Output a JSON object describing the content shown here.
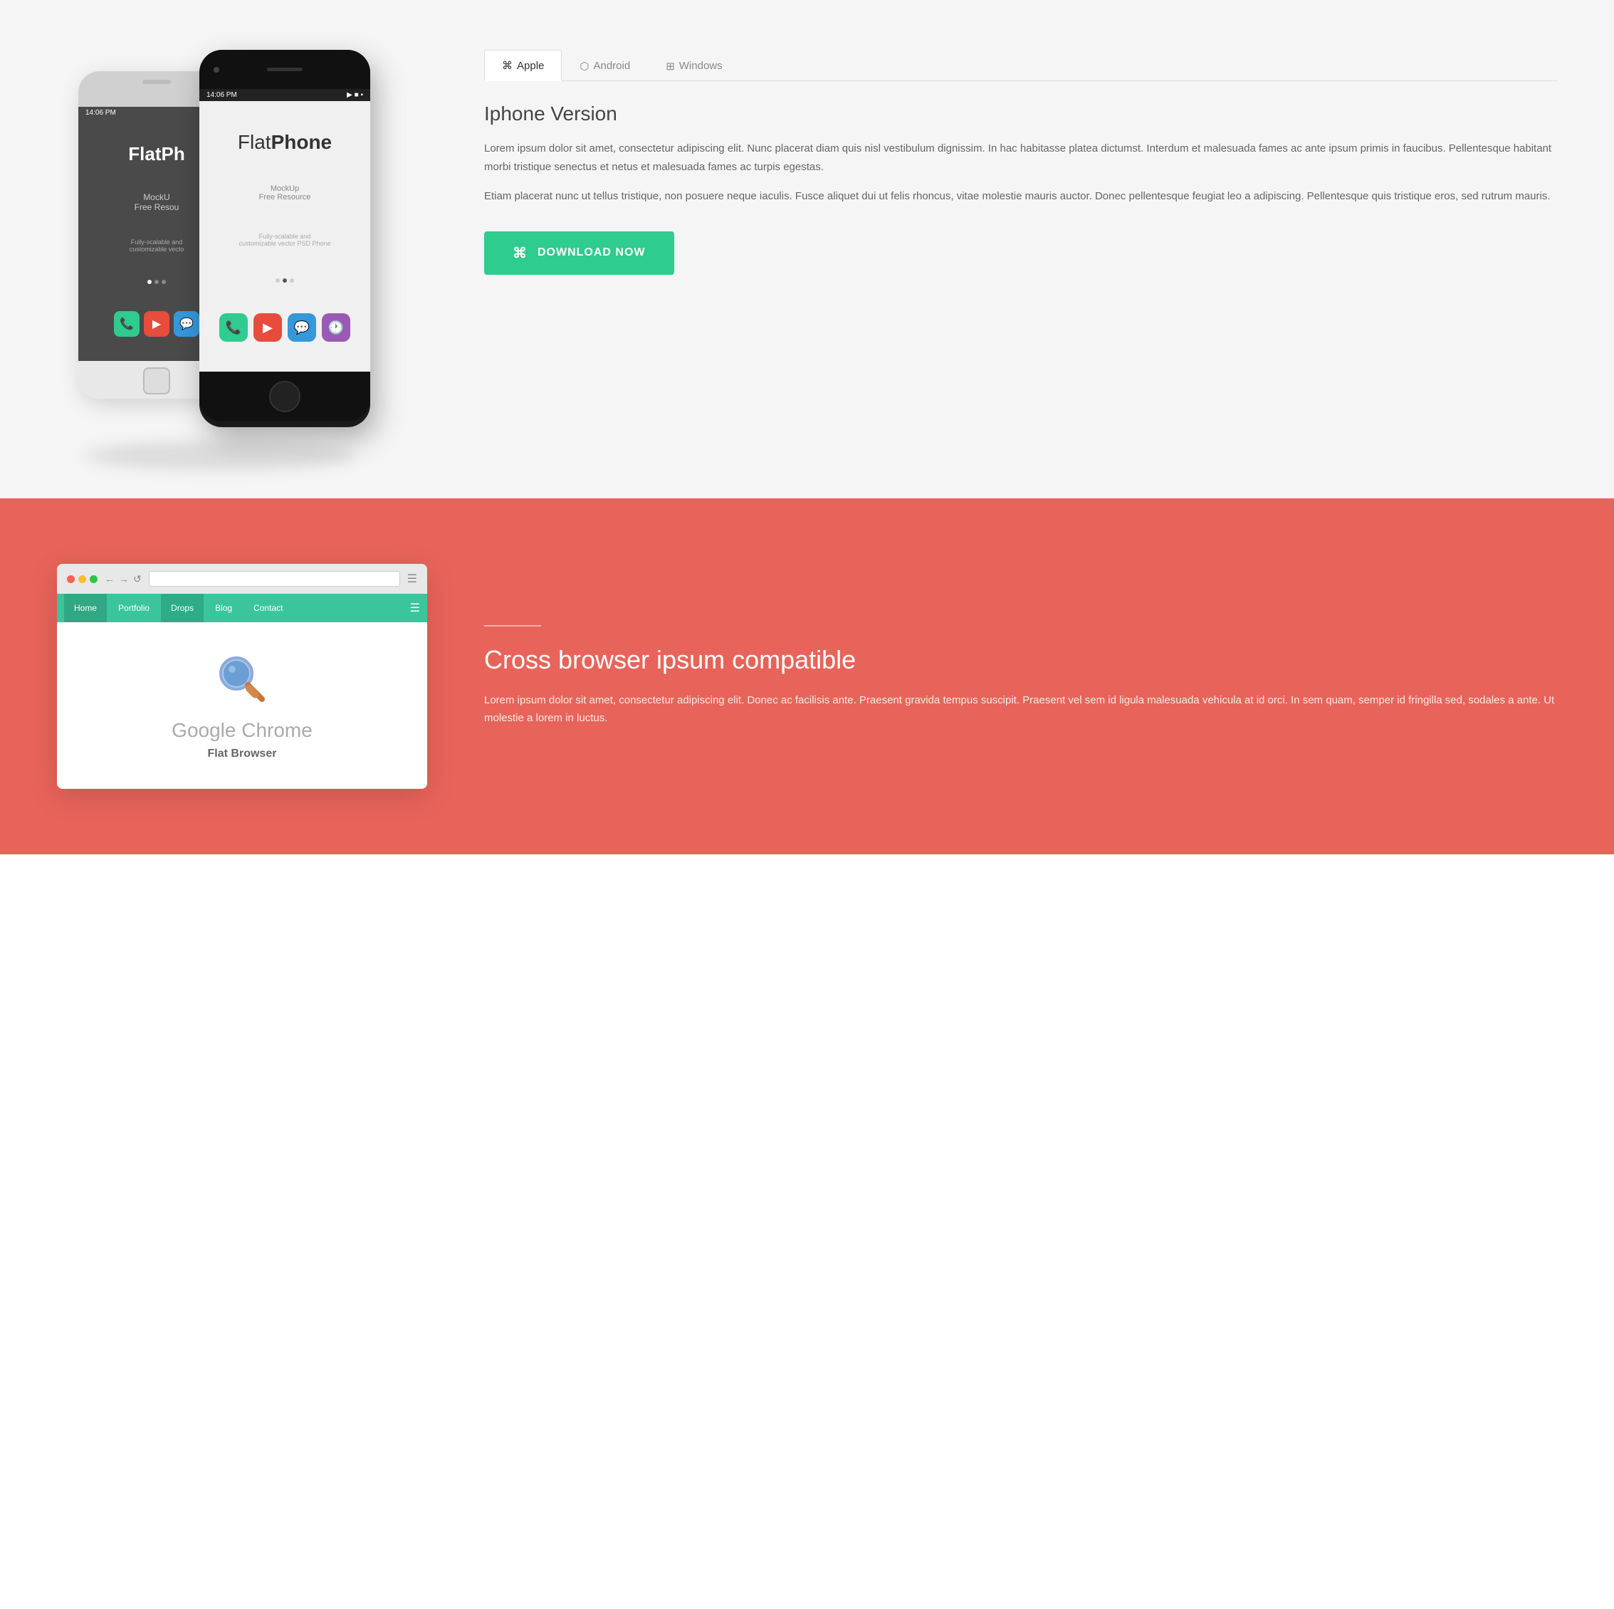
{
  "section1": {
    "phone_white": {
      "time": "14:06 PM",
      "app_name_light": "FlatPh",
      "app_name_bold": "",
      "mockup_line1": "MockU",
      "mockup_line2": "Free Resou",
      "description": "Fully-scalable and customizable vecto",
      "icons": [
        "phone",
        "play",
        "chat"
      ]
    },
    "phone_black": {
      "time": "14:06 PM",
      "app_name_light": "Flat",
      "app_name_bold": "Phone",
      "mockup_line1": "MockUp",
      "mockup_line2": "Free Resource",
      "description": "Fully-scalable and customizable vector PSD Phone",
      "icons": [
        "phone",
        "play",
        "chat",
        "clock"
      ]
    },
    "tabs": [
      {
        "label": "Apple",
        "icon": "apple",
        "active": true
      },
      {
        "label": "Android",
        "icon": "android",
        "active": false
      },
      {
        "label": "Windows",
        "icon": "windows",
        "active": false
      }
    ],
    "version_title": "Iphone Version",
    "description1": "Lorem ipsum dolor sit amet, consectetur adipiscing elit. Nunc placerat diam quis nisl vestibulum dignissim. In hac habitasse platea dictumst. Interdum et malesuada fames ac ante ipsum primis in faucibus. Pellentesque habitant morbi tristique senectus et netus et malesuada fames ac turpis egestas.",
    "description2": "Etiam placerat nunc ut tellus tristique, non posuere neque iaculis. Fusce aliquet dui ut felis rhoncus, vitae molestie mauris auctor. Donec pellentesque feugiat leo a adipiscing. Pellentesque quis tristique eros, sed rutrum mauris.",
    "download_btn": "DOWNLOAD NOW"
  },
  "section2": {
    "browser": {
      "dots": [
        "red",
        "yellow",
        "green"
      ],
      "nav_items": [
        "Home",
        "Portfolio",
        "Drops",
        "Blog",
        "Contact"
      ],
      "active_nav": "Drops",
      "app_name": "Google Chrome",
      "app_sub": "Flat Browser"
    },
    "divider": true,
    "title": "Cross browser ipsum compatible",
    "description": "Lorem ipsum dolor sit amet, consectetur adipiscing elit. Donec ac facilisis ante. Praesent gravida tempus suscipit. Praesent vel sem id ligula malesuada vehicula at id orci. In sem quam, semper id fringilla sed, sodales a ante. Ut molestie a lorem in luctus."
  }
}
